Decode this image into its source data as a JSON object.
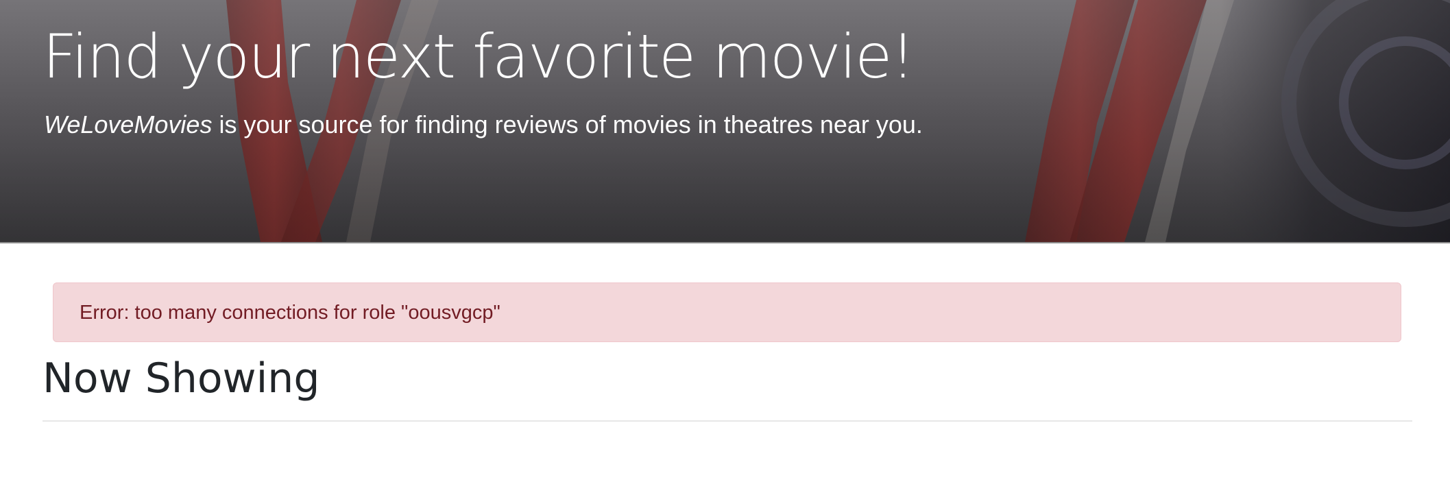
{
  "hero": {
    "title": "Find your next favorite movie!",
    "brand": "WeLoveMovies",
    "subtitle_rest": " is your source for finding reviews of movies in theatres near you."
  },
  "alert": {
    "message": "Error: too many connections for role \"oousvgcp\"",
    "background": "#f3d7da",
    "text_color": "#721c24"
  },
  "main": {
    "section_title": "Now Showing"
  }
}
